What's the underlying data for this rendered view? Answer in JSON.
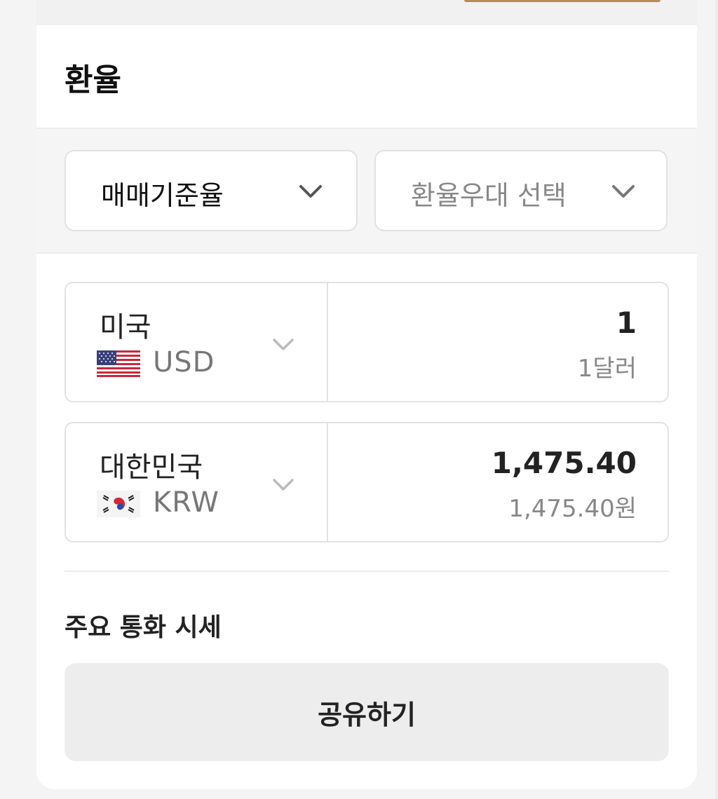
{
  "header": {
    "title": "환율"
  },
  "filters": {
    "rate_type": "매매기준율",
    "preferential": "환율우대 선택"
  },
  "conversion": {
    "from": {
      "country": "미국",
      "code": "USD",
      "amount": "1",
      "amount_text": "1달러",
      "flag_icon": "us-flag-icon"
    },
    "to": {
      "country": "대한민국",
      "code": "KRW",
      "amount": "1,475.40",
      "amount_text": "1,475.40원",
      "flag_icon": "kr-flag-icon"
    }
  },
  "section": {
    "title": "주요 통화 시세"
  },
  "actions": {
    "share_label": "공유하기"
  },
  "colors": {
    "accent_strip": "#b98a5a",
    "muted_text": "#888888",
    "border": "#e2e2e2"
  }
}
